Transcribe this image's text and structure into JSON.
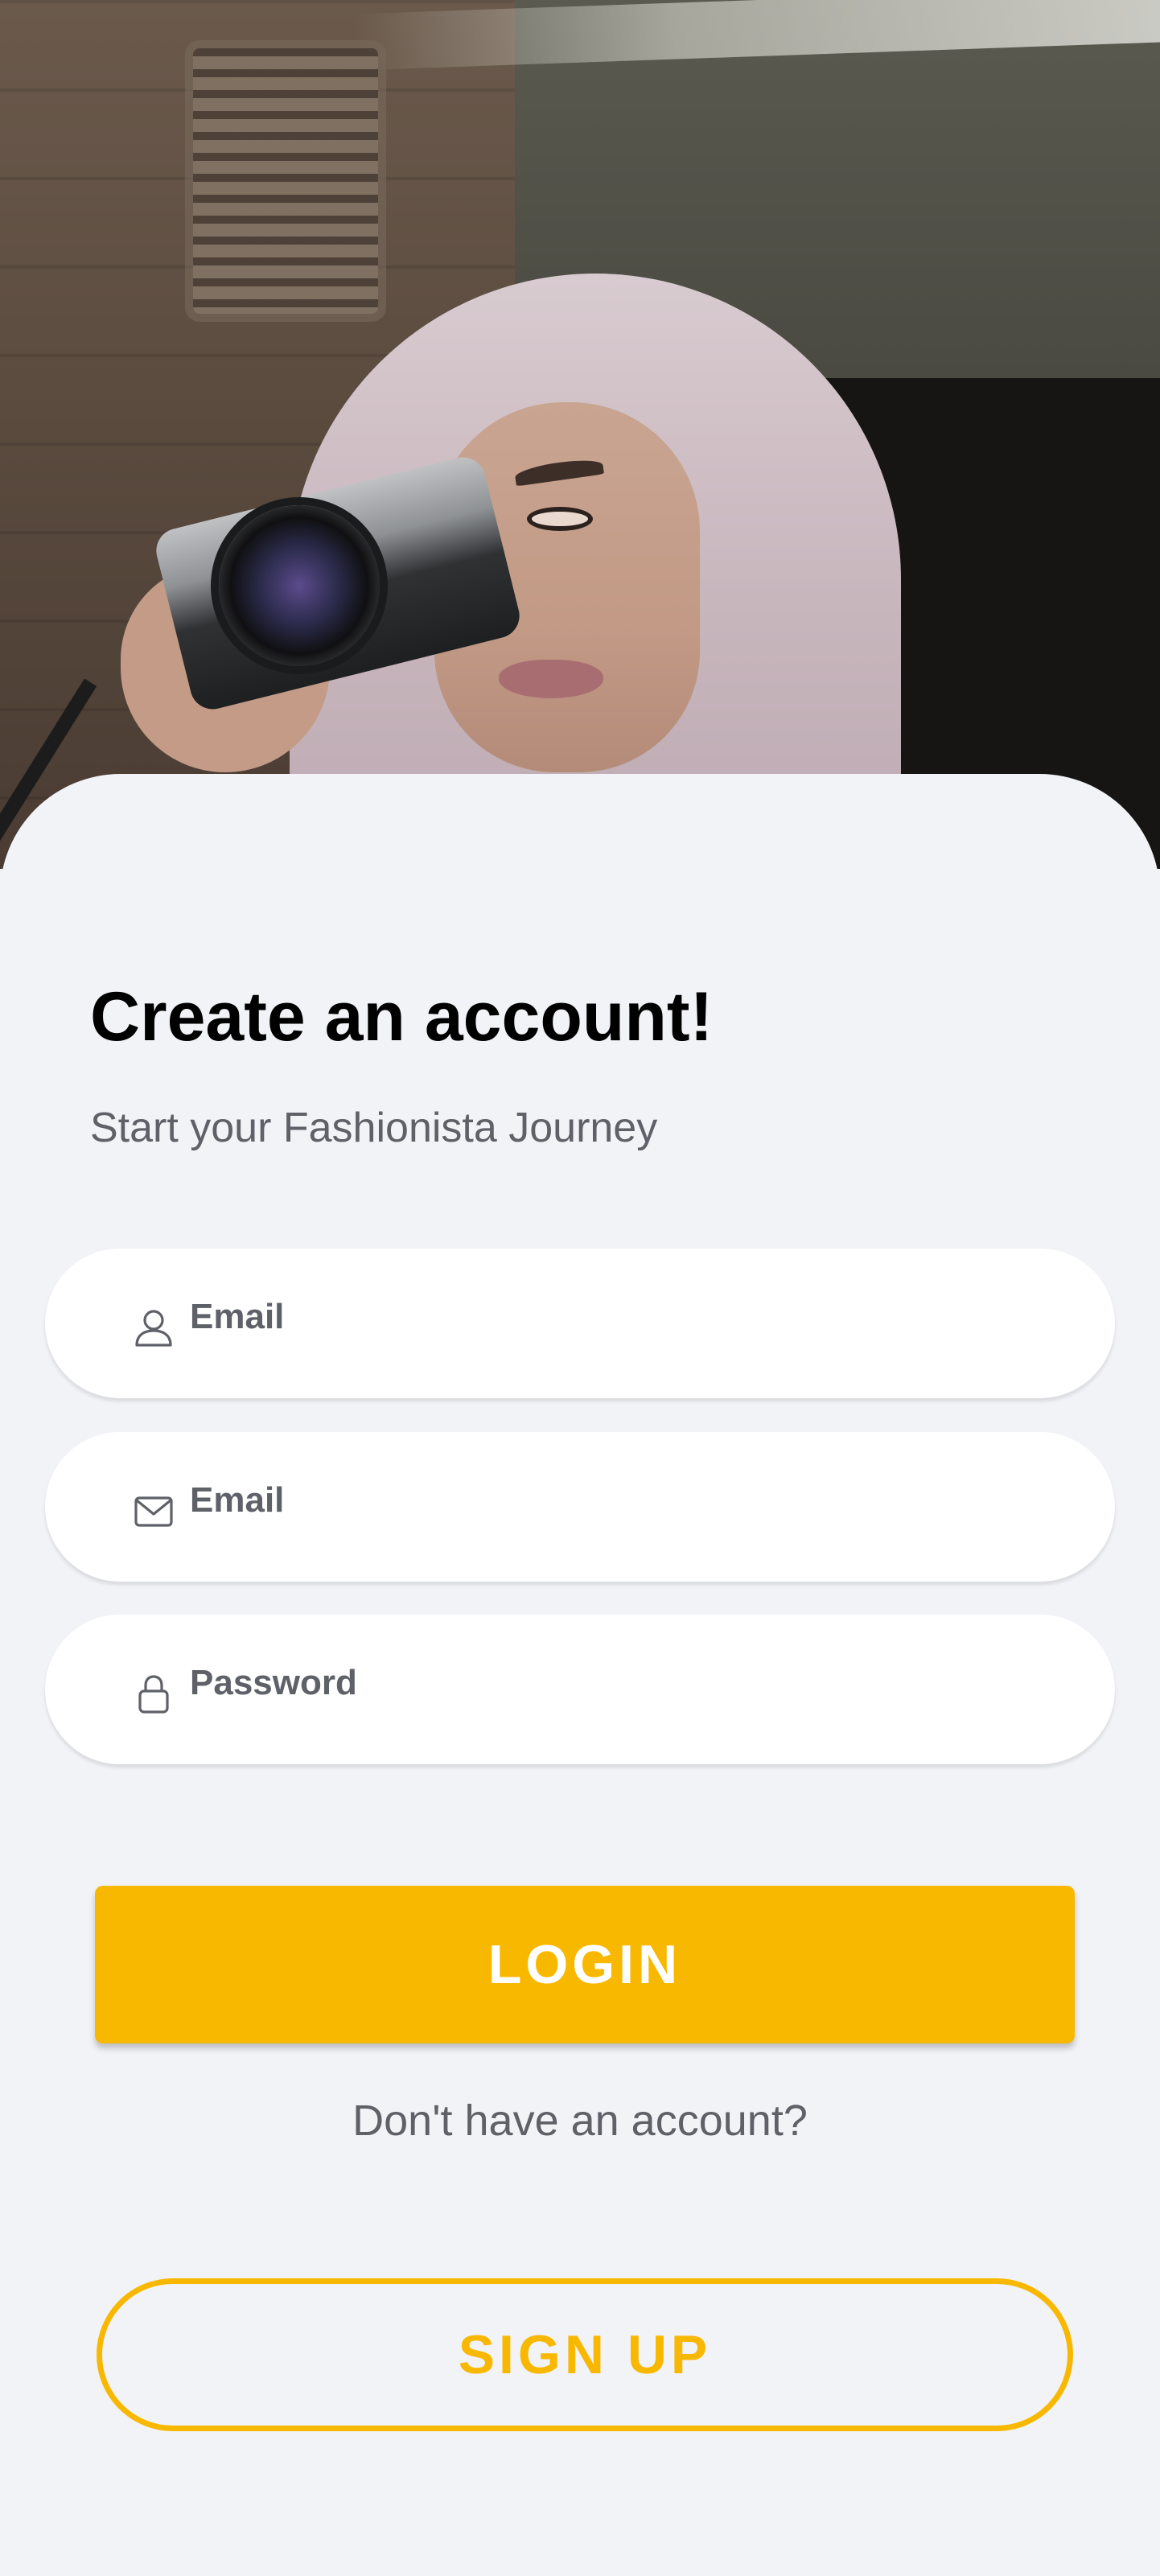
{
  "header": {
    "title": "Create an account!",
    "subtitle": "Start your Fashionista Journey"
  },
  "form": {
    "fields": [
      {
        "icon": "user-icon",
        "placeholder": "Email"
      },
      {
        "icon": "mail-icon",
        "placeholder": "Email"
      },
      {
        "icon": "lock-icon",
        "placeholder": "Password"
      }
    ]
  },
  "actions": {
    "login_label": "LOGIN",
    "no_account_prompt": "Don't have an account?",
    "signup_label": "SIGN UP"
  },
  "colors": {
    "accent": "#f9b800",
    "background": "#f2f3f7",
    "muted_text": "#5f6168"
  }
}
